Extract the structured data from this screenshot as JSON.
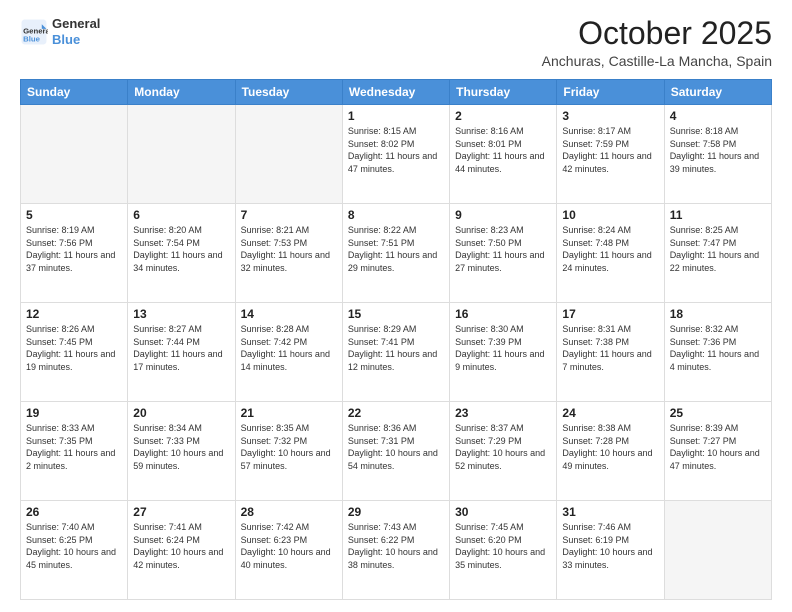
{
  "logo": {
    "line1": "General",
    "line2": "Blue"
  },
  "header": {
    "month": "October 2025",
    "location": "Anchuras, Castille-La Mancha, Spain"
  },
  "weekdays": [
    "Sunday",
    "Monday",
    "Tuesday",
    "Wednesday",
    "Thursday",
    "Friday",
    "Saturday"
  ],
  "weeks": [
    [
      {
        "day": "",
        "info": ""
      },
      {
        "day": "",
        "info": ""
      },
      {
        "day": "",
        "info": ""
      },
      {
        "day": "1",
        "info": "Sunrise: 8:15 AM\nSunset: 8:02 PM\nDaylight: 11 hours and 47 minutes."
      },
      {
        "day": "2",
        "info": "Sunrise: 8:16 AM\nSunset: 8:01 PM\nDaylight: 11 hours and 44 minutes."
      },
      {
        "day": "3",
        "info": "Sunrise: 8:17 AM\nSunset: 7:59 PM\nDaylight: 11 hours and 42 minutes."
      },
      {
        "day": "4",
        "info": "Sunrise: 8:18 AM\nSunset: 7:58 PM\nDaylight: 11 hours and 39 minutes."
      }
    ],
    [
      {
        "day": "5",
        "info": "Sunrise: 8:19 AM\nSunset: 7:56 PM\nDaylight: 11 hours and 37 minutes."
      },
      {
        "day": "6",
        "info": "Sunrise: 8:20 AM\nSunset: 7:54 PM\nDaylight: 11 hours and 34 minutes."
      },
      {
        "day": "7",
        "info": "Sunrise: 8:21 AM\nSunset: 7:53 PM\nDaylight: 11 hours and 32 minutes."
      },
      {
        "day": "8",
        "info": "Sunrise: 8:22 AM\nSunset: 7:51 PM\nDaylight: 11 hours and 29 minutes."
      },
      {
        "day": "9",
        "info": "Sunrise: 8:23 AM\nSunset: 7:50 PM\nDaylight: 11 hours and 27 minutes."
      },
      {
        "day": "10",
        "info": "Sunrise: 8:24 AM\nSunset: 7:48 PM\nDaylight: 11 hours and 24 minutes."
      },
      {
        "day": "11",
        "info": "Sunrise: 8:25 AM\nSunset: 7:47 PM\nDaylight: 11 hours and 22 minutes."
      }
    ],
    [
      {
        "day": "12",
        "info": "Sunrise: 8:26 AM\nSunset: 7:45 PM\nDaylight: 11 hours and 19 minutes."
      },
      {
        "day": "13",
        "info": "Sunrise: 8:27 AM\nSunset: 7:44 PM\nDaylight: 11 hours and 17 minutes."
      },
      {
        "day": "14",
        "info": "Sunrise: 8:28 AM\nSunset: 7:42 PM\nDaylight: 11 hours and 14 minutes."
      },
      {
        "day": "15",
        "info": "Sunrise: 8:29 AM\nSunset: 7:41 PM\nDaylight: 11 hours and 12 minutes."
      },
      {
        "day": "16",
        "info": "Sunrise: 8:30 AM\nSunset: 7:39 PM\nDaylight: 11 hours and 9 minutes."
      },
      {
        "day": "17",
        "info": "Sunrise: 8:31 AM\nSunset: 7:38 PM\nDaylight: 11 hours and 7 minutes."
      },
      {
        "day": "18",
        "info": "Sunrise: 8:32 AM\nSunset: 7:36 PM\nDaylight: 11 hours and 4 minutes."
      }
    ],
    [
      {
        "day": "19",
        "info": "Sunrise: 8:33 AM\nSunset: 7:35 PM\nDaylight: 11 hours and 2 minutes."
      },
      {
        "day": "20",
        "info": "Sunrise: 8:34 AM\nSunset: 7:33 PM\nDaylight: 10 hours and 59 minutes."
      },
      {
        "day": "21",
        "info": "Sunrise: 8:35 AM\nSunset: 7:32 PM\nDaylight: 10 hours and 57 minutes."
      },
      {
        "day": "22",
        "info": "Sunrise: 8:36 AM\nSunset: 7:31 PM\nDaylight: 10 hours and 54 minutes."
      },
      {
        "day": "23",
        "info": "Sunrise: 8:37 AM\nSunset: 7:29 PM\nDaylight: 10 hours and 52 minutes."
      },
      {
        "day": "24",
        "info": "Sunrise: 8:38 AM\nSunset: 7:28 PM\nDaylight: 10 hours and 49 minutes."
      },
      {
        "day": "25",
        "info": "Sunrise: 8:39 AM\nSunset: 7:27 PM\nDaylight: 10 hours and 47 minutes."
      }
    ],
    [
      {
        "day": "26",
        "info": "Sunrise: 7:40 AM\nSunset: 6:25 PM\nDaylight: 10 hours and 45 minutes."
      },
      {
        "day": "27",
        "info": "Sunrise: 7:41 AM\nSunset: 6:24 PM\nDaylight: 10 hours and 42 minutes."
      },
      {
        "day": "28",
        "info": "Sunrise: 7:42 AM\nSunset: 6:23 PM\nDaylight: 10 hours and 40 minutes."
      },
      {
        "day": "29",
        "info": "Sunrise: 7:43 AM\nSunset: 6:22 PM\nDaylight: 10 hours and 38 minutes."
      },
      {
        "day": "30",
        "info": "Sunrise: 7:45 AM\nSunset: 6:20 PM\nDaylight: 10 hours and 35 minutes."
      },
      {
        "day": "31",
        "info": "Sunrise: 7:46 AM\nSunset: 6:19 PM\nDaylight: 10 hours and 33 minutes."
      },
      {
        "day": "",
        "info": ""
      }
    ]
  ]
}
